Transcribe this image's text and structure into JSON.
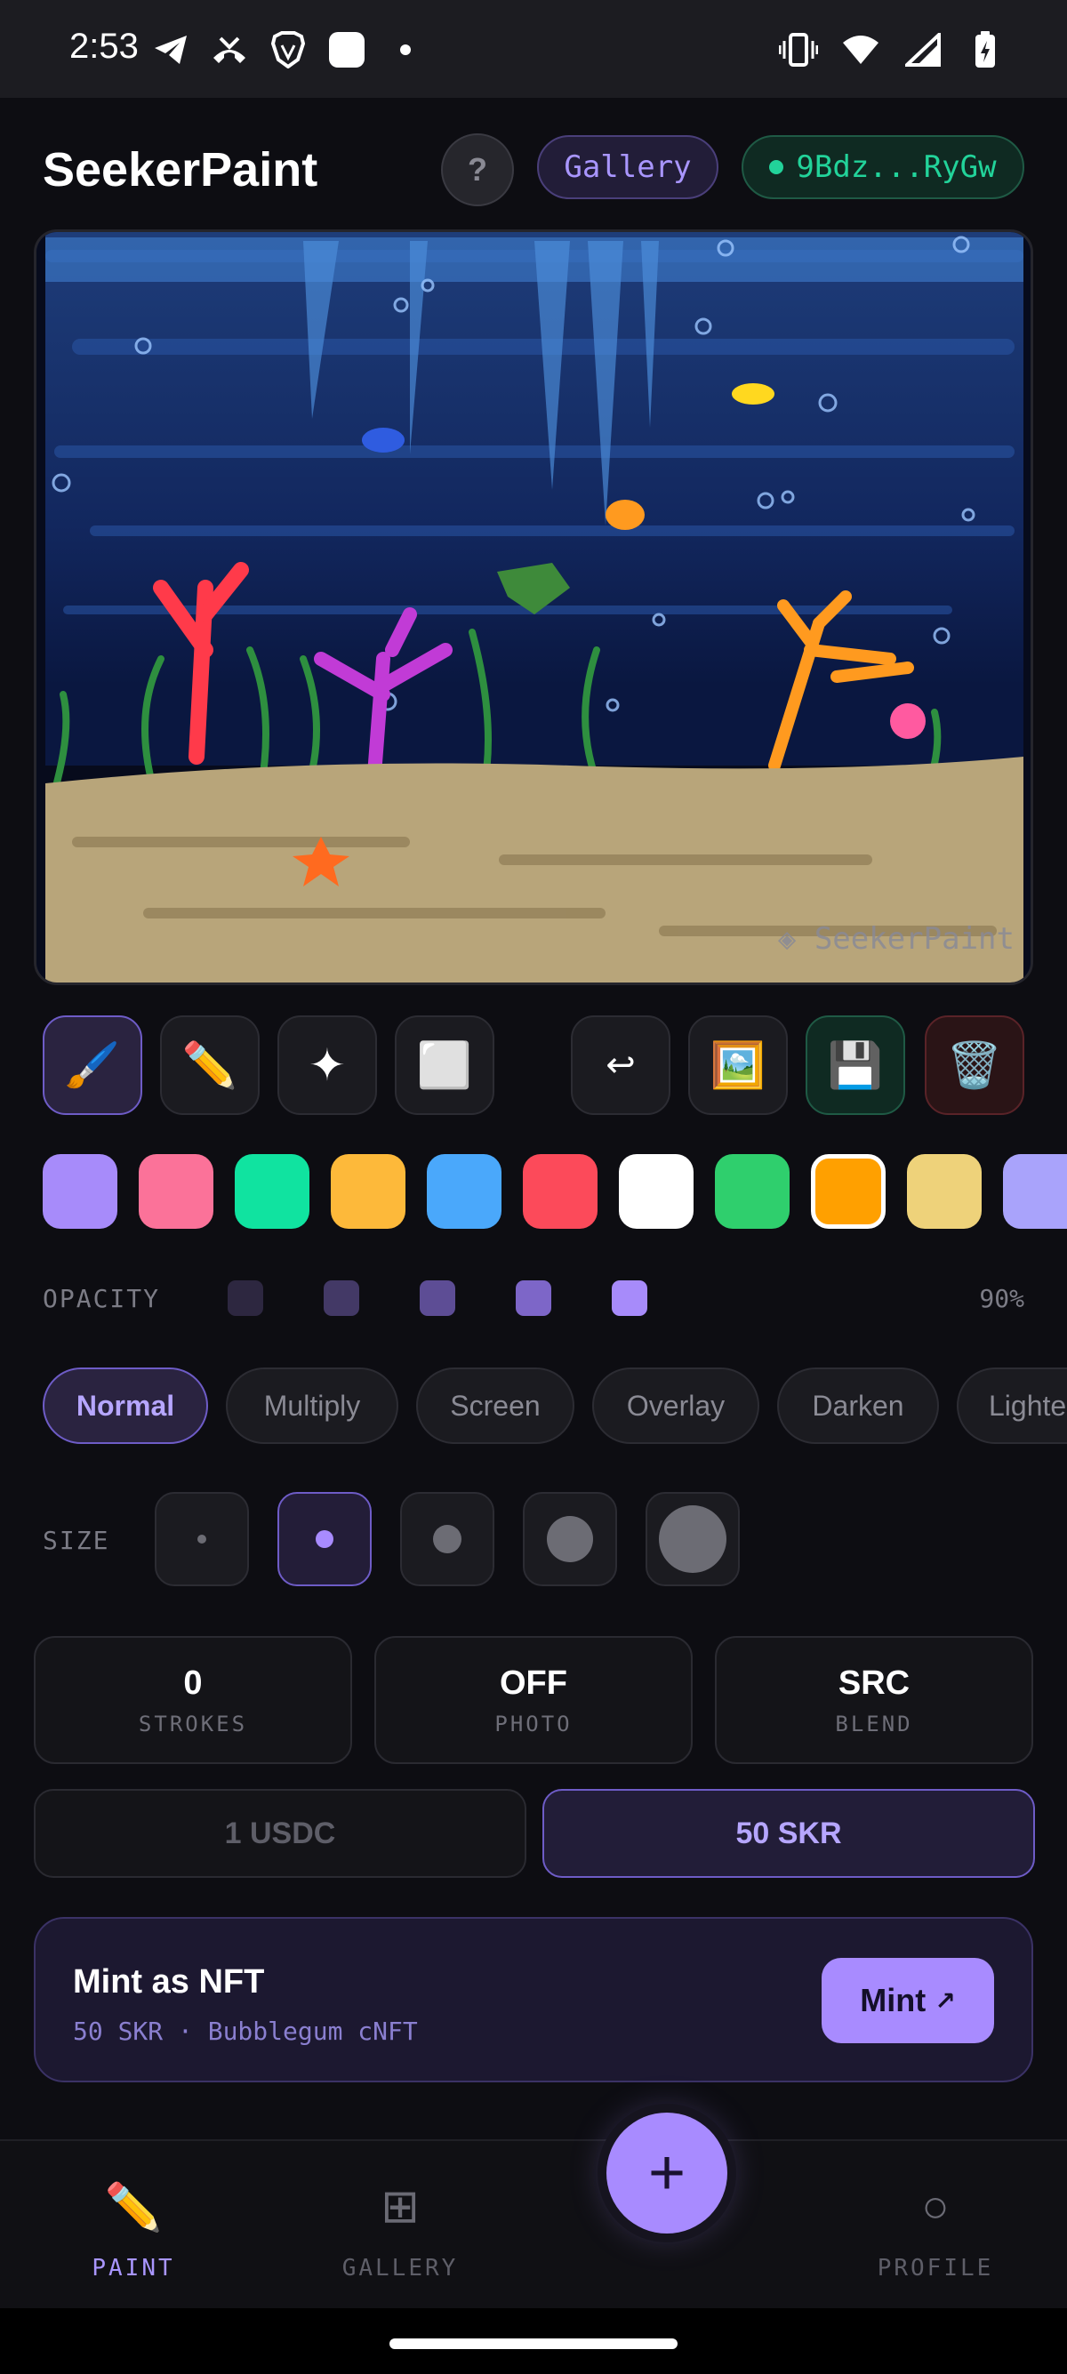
{
  "status_bar": {
    "time": "2:53",
    "left_icons": [
      "telegram-icon",
      "missed-call-icon",
      "brave-icon",
      "app-square-icon",
      "dot-icon"
    ],
    "right_icons": [
      "vibrate-icon",
      "wifi-icon",
      "signal-icon",
      "battery-charging-icon"
    ]
  },
  "header": {
    "title": "SeekerPaint",
    "help_label": "?",
    "gallery_label": "Gallery",
    "wallet_label": "9Bdz...RyGw",
    "wallet_status_color": "#22d39a"
  },
  "canvas": {
    "watermark": "◈ SeekerPaint"
  },
  "toolbar": {
    "tools": [
      {
        "name": "brush",
        "icon": "🖌️",
        "active": true
      },
      {
        "name": "pencil",
        "icon": "✏️",
        "active": false
      },
      {
        "name": "sparkle",
        "icon": "✦",
        "active": false
      },
      {
        "name": "eraser",
        "icon": "⬜",
        "active": false
      }
    ],
    "actions": [
      {
        "name": "undo",
        "icon": "↩"
      },
      {
        "name": "photo",
        "icon": "🖼️"
      },
      {
        "name": "save",
        "icon": "💾"
      },
      {
        "name": "clear",
        "icon": "🗑️"
      }
    ]
  },
  "palette": {
    "colors": [
      "#a78bfa",
      "#fb7299",
      "#10e3a0",
      "#fdb93a",
      "#4aa8fb",
      "#fc4a5a",
      "#ffffff",
      "#2fcf6d",
      "#ffa000",
      "#eed27a",
      "#a9a3fb"
    ],
    "selected_index": 8
  },
  "opacity": {
    "label": "OPACITY",
    "value": "90%",
    "levels": [
      "#2d2740",
      "#433966",
      "#5d4d95",
      "#7d66c8",
      "#a78bfa"
    ]
  },
  "blend_modes": {
    "items": [
      "Normal",
      "Multiply",
      "Screen",
      "Overlay",
      "Darken",
      "Lighten"
    ],
    "active_index": 0
  },
  "size": {
    "label": "SIZE",
    "options": [
      1,
      2,
      3,
      4,
      5
    ],
    "active_index": 1
  },
  "stats": [
    {
      "value": "0",
      "label": "STROKES"
    },
    {
      "value": "OFF",
      "label": "PHOTO"
    },
    {
      "value": "SRC",
      "label": "BLEND"
    }
  ],
  "currency": {
    "options": [
      "1 USDC",
      "50 SKR"
    ],
    "active_index": 1
  },
  "mint": {
    "title": "Mint as NFT",
    "subtitle": "50 SKR · Bubblegum cNFT",
    "button_label": "Mint",
    "button_icon": "↗"
  },
  "nav": {
    "items": [
      {
        "label": "PAINT",
        "icon": "✏️",
        "active": true
      },
      {
        "label": "GALLERY",
        "icon": "⊞",
        "active": false
      },
      {
        "label": "PROFILE",
        "icon": "○",
        "active": false
      }
    ],
    "fab_icon": "+"
  }
}
